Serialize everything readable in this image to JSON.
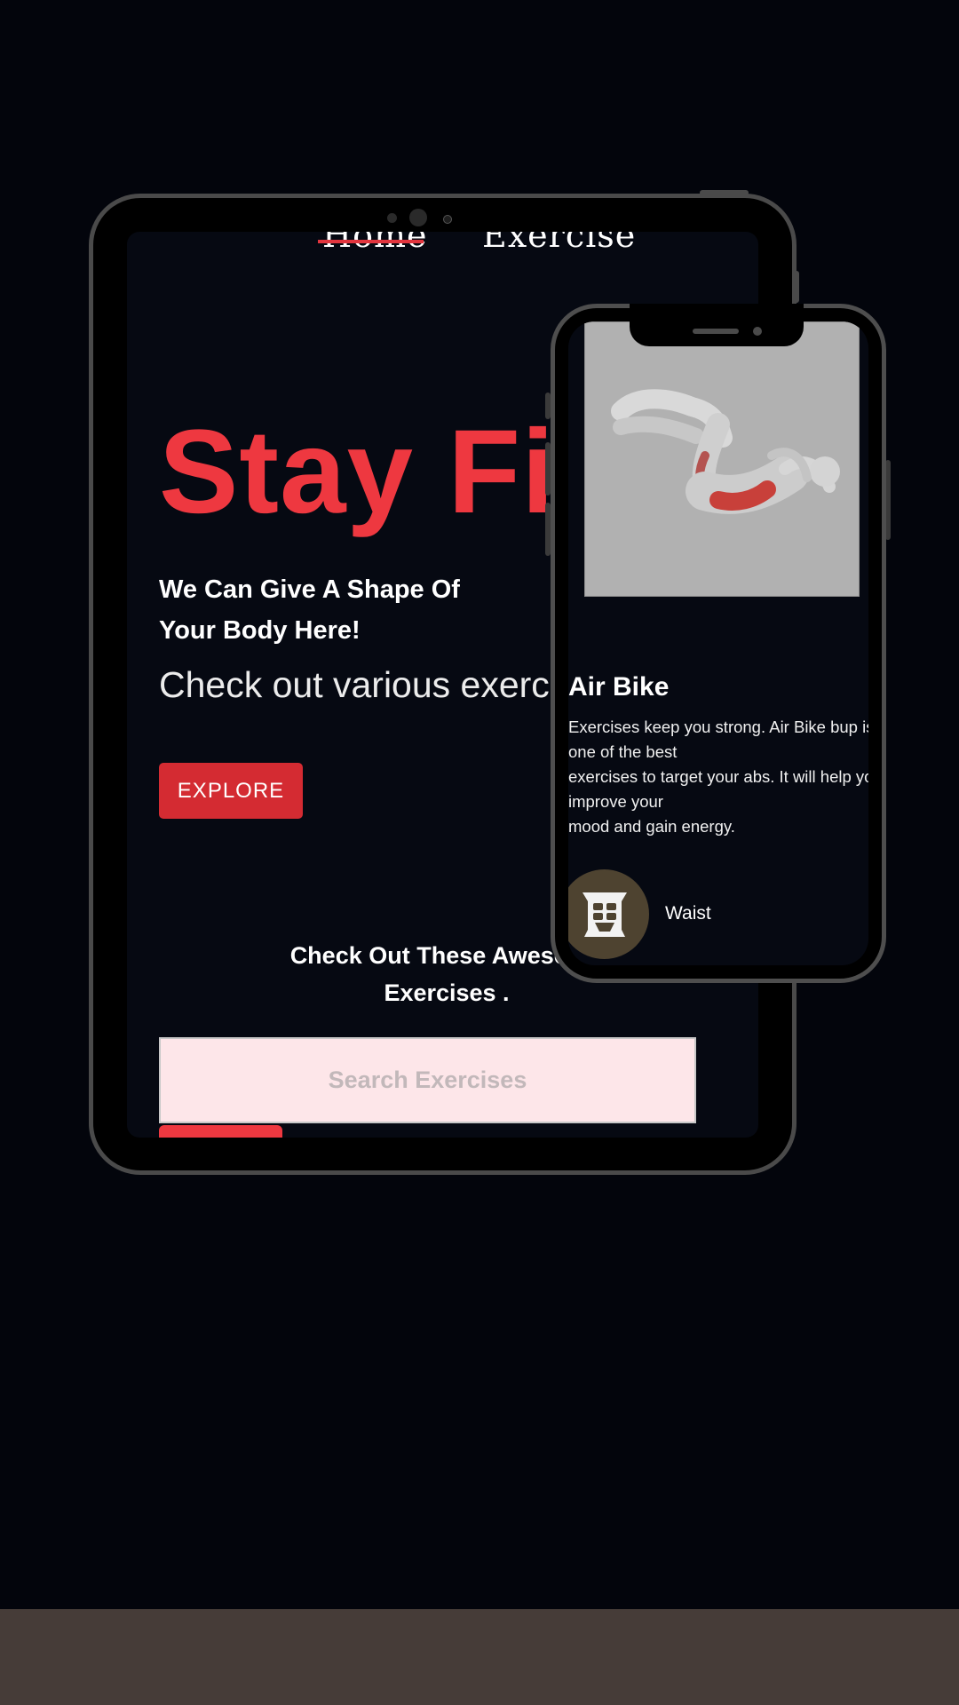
{
  "tablet": {
    "nav": {
      "home_label": "Home",
      "exercise_label": "Exercise"
    },
    "hero": {
      "title": "Stay Fit",
      "subtitle_line1": "We Can Give A Shape Of",
      "subtitle_line2": "Your Body Here!",
      "description": "Check out various exercises",
      "explore_label": "EXPLORE"
    },
    "section": {
      "title_line1": "Check Out These Awesome",
      "title_line2": "Exercises ."
    },
    "search": {
      "placeholder": "Search Exercises"
    }
  },
  "phone": {
    "exercise": {
      "image_icon": "abs-exercise-illustration",
      "title": "Air Bike",
      "description_lines": [
        "Exercises keep you strong. Air Bike bup is",
        "one of the best",
        "exercises to target your abs. It will help you",
        "improve your",
        "mood and gain energy."
      ]
    },
    "tag": {
      "icon": "waist-abs-icon",
      "label": "Waist"
    }
  },
  "colors": {
    "background": "#03050c",
    "accent": "#ee3840",
    "button": "#d42b32",
    "search_bg": "#fde6e9",
    "tag_circle": "#4e4330",
    "footer_band": "#463c38"
  }
}
